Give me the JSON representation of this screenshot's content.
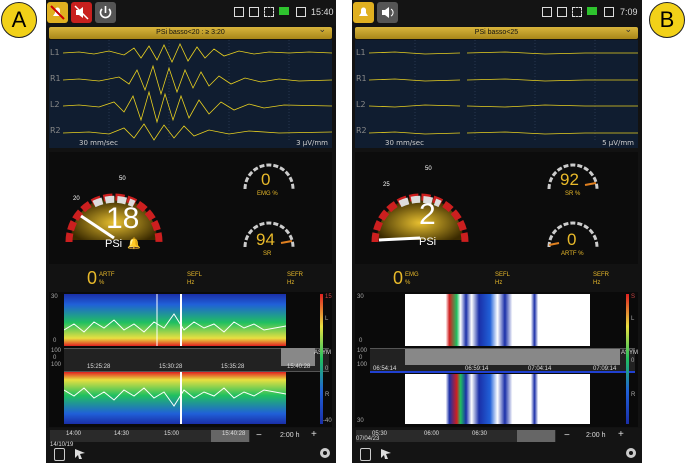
{
  "badges": {
    "a": "A",
    "b": "B"
  },
  "panel_a": {
    "time": "15:40",
    "header": "PSi basso<20 : ≥ 3:20",
    "channels": [
      "L1",
      "R1",
      "L2",
      "R2"
    ],
    "speed": "30 mm/sec",
    "amplitude": "3 µV/mm",
    "psi_value": "18",
    "psi_label": "PSi",
    "gauge_ticks": [
      "20",
      "50"
    ],
    "emg_value": "0",
    "emg_label": "EMG %",
    "sr_value": "94",
    "sr_label": "SR",
    "artf_value": "0",
    "artf_label": "ARTF",
    "artf_unit": "%",
    "sefl_label": "SEFL",
    "sefl_unit": "Hz",
    "sefr_label": "SEFR",
    "sefr_unit": "Hz",
    "spec_left_axis": [
      "30",
      "0"
    ],
    "spec_right_axis": [
      "15",
      "L",
      "0",
      "R",
      "-40"
    ],
    "asym_label": "ASYM",
    "asym_left": [
      "100",
      "0",
      "100"
    ],
    "spec_times": [
      "15:25:28",
      "15:30:28",
      "15:35:28",
      "15:40:28"
    ],
    "timeline": [
      "14:00",
      "14:30",
      "15:00",
      "15:40:28"
    ],
    "date": "14/10/19",
    "minus": "−",
    "plus": "+",
    "range": "2:00 h"
  },
  "panel_b": {
    "time": "7:09",
    "header": "PSi basso<25",
    "channels": [
      "L1",
      "R1",
      "L2",
      "R2"
    ],
    "speed": "30 mm/sec",
    "amplitude": "5 µV/mm",
    "psi_value": "2",
    "psi_label": "PSi",
    "gauge_ticks": [
      "25",
      "50"
    ],
    "sr_value": "92",
    "sr_label": "SR %",
    "artf_value": "0",
    "artf_label": "ARTF %",
    "emg_value": "0",
    "emg_label": "EMG",
    "emg_unit": "%",
    "sefl_label": "SEFL",
    "sefl_unit": "Hz",
    "sefr_label": "SEFR",
    "sefr_unit": "Hz",
    "spec_left_axis": [
      "30",
      "0",
      "30"
    ],
    "spec_right_axis": [
      "S",
      "L",
      "0",
      "R"
    ],
    "asym_label": "ASYM",
    "asym_left": [
      "100",
      "0",
      "100"
    ],
    "spec_times": [
      "06:54:14",
      "06:59:14",
      "07:04:14",
      "07:09:14"
    ],
    "timeline": [
      "05:30",
      "06:00",
      "06:30"
    ],
    "date": "07/04/23",
    "minus": "−",
    "plus": "+",
    "range": "2:00 h"
  },
  "colors": {
    "accent": "#e8b92a",
    "red": "#d01e1e",
    "eeg_bg": "#101d30"
  }
}
